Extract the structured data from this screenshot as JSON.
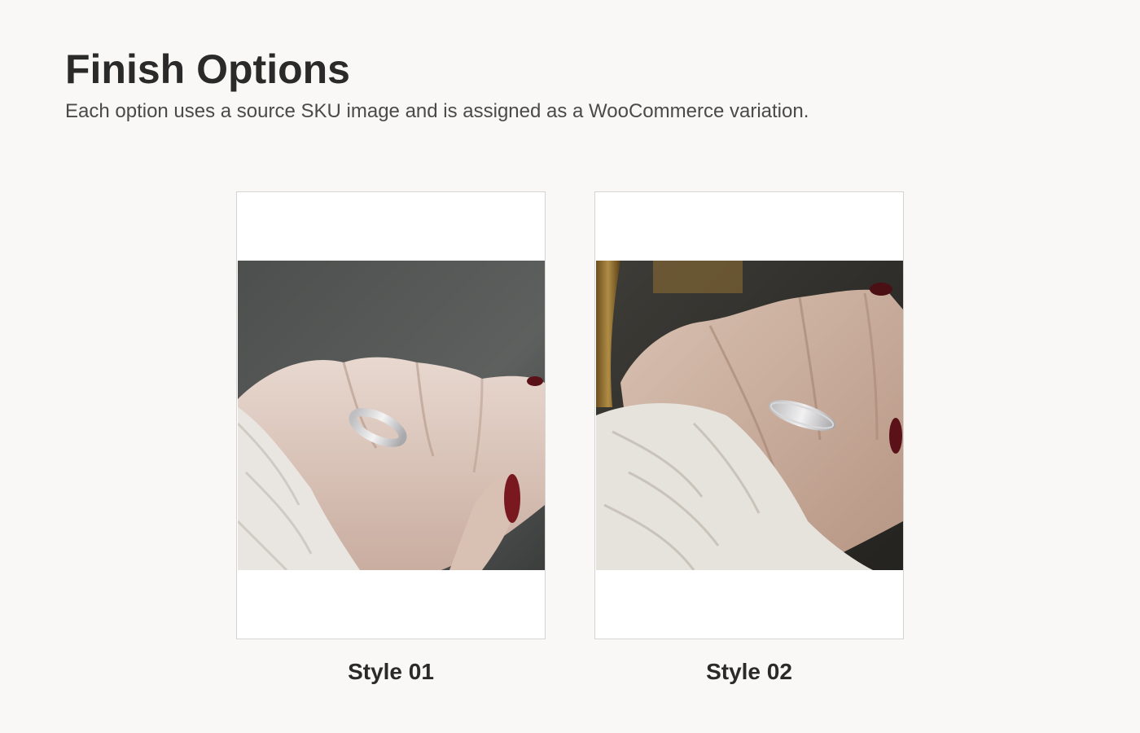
{
  "header": {
    "title": "Finish Options",
    "subtitle": "Each option uses a source SKU image and is assigned as a WooCommerce variation."
  },
  "options": [
    {
      "label": "Style 01",
      "image": "hand-with-textured-silver-ring-photo"
    },
    {
      "label": "Style 02",
      "image": "hand-with-textured-silver-ring-photo"
    }
  ],
  "colors": {
    "page_background": "#f9f8f6",
    "card_background": "#ffffff",
    "card_border": "#d6d4d0",
    "text_primary": "#2a2a2a",
    "text_secondary": "#4a4a4a"
  }
}
